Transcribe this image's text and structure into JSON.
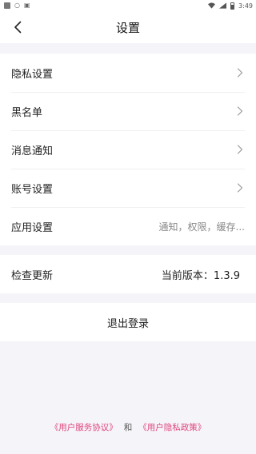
{
  "status_bar": {
    "time": "3:49",
    "left_icons": [
      "app-square-icon",
      "chat-bubble-icon",
      "a-letter-icon"
    ],
    "right_icons": [
      "wifi-icon",
      "signal-icon",
      "battery-icon"
    ]
  },
  "header": {
    "title": "设置",
    "back_icon": "chevron-left-icon"
  },
  "settings_items": [
    {
      "label": "隐私设置",
      "value": "",
      "chevron": true
    },
    {
      "label": "黑名单",
      "value": "",
      "chevron": true
    },
    {
      "label": "消息通知",
      "value": "",
      "chevron": true
    },
    {
      "label": "账号设置",
      "value": "",
      "chevron": true
    },
    {
      "label": "应用设置",
      "value": "通知，权限，缓存...",
      "chevron": false
    }
  ],
  "update": {
    "label": "检查更新",
    "version": "当前版本：1.3.9"
  },
  "logout": {
    "label": "退出登录"
  },
  "footer": {
    "agreement": "《用户服务协议》",
    "and": "和",
    "privacy": "《用户隐私政策》"
  },
  "colors": {
    "accent": "#e0467c",
    "background": "#f5f4f8"
  }
}
